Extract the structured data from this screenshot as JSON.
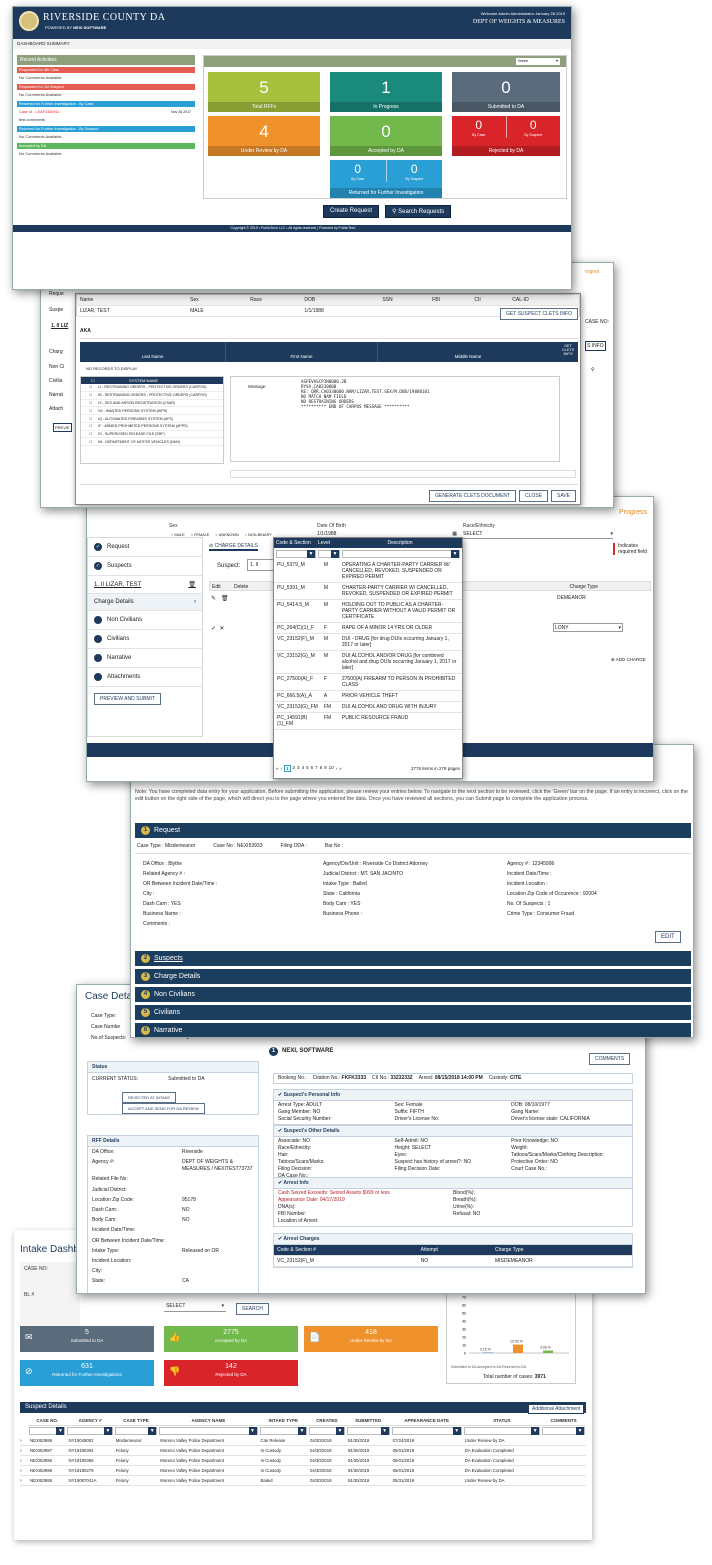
{
  "win1": {
    "brand": "RIVERSIDE COUNTY DA",
    "powered": "POWERED BY",
    "vendor": "NEXI SOFTWARE",
    "welcome": "Welcome Admin Administrator January 28 2019",
    "dept": "DEPT OF WEIGHTS & MEASURES",
    "page_label": "DASHBOARD SUMMARY",
    "recent_header": "Recent Activities",
    "activities": [
      {
        "title": "Requested for 4th Case",
        "text": "No Comments Available.",
        "color": "#e45b4f",
        "date": ""
      },
      {
        "title": "Requested for 1st Suspect",
        "text": "No Comments Available.",
        "color": "#e45b4f",
        "date": ""
      },
      {
        "title": "Returned for Further Investigation - By Case",
        "text": "",
        "color": "#2a9fd6",
        "date": ""
      },
      {
        "title": "Case Id - LEAF3330911",
        "text": "test comments",
        "color": "#ffffff",
        "date": "Nov 28 2017"
      },
      {
        "title": "Returned for Further Investigation - By Suspect",
        "text": "No Comments Available.",
        "color": "#2a9fd6",
        "date": ""
      },
      {
        "title": "Accepted by DA",
        "text": "No Comments Available.",
        "color": "#5cb85c",
        "date": ""
      }
    ],
    "select_value": "Week",
    "tiles": [
      {
        "value": "5",
        "label": "Total RFFs",
        "color": "#a7c13e"
      },
      {
        "value": "1",
        "label": "In Progress",
        "color": "#1a8a7c"
      },
      {
        "value": "0",
        "label": "Submitted to DA",
        "color": "#5a6b7c"
      },
      {
        "value": "4",
        "label": "Under Review by DA",
        "color": "#f0922c"
      },
      {
        "value": "0",
        "label": "Accepted by DA",
        "color": "#72b84a"
      }
    ],
    "rejected": {
      "case": "0",
      "suspect": "0",
      "case_lbl": "By Case",
      "suspect_lbl": "By Suspect",
      "label": "Rejected by DA"
    },
    "returned": {
      "case": "0",
      "suspect": "0",
      "case_lbl": "By Case",
      "suspect_lbl": "By Suspect",
      "label": "Returned for Further Investigation"
    },
    "create_btn": "Create Request",
    "search_btn": "Search Requests",
    "copyright": "Copyright © 2019 • PublicTech LLC • All rights reserved | Powered by PublicTech"
  },
  "win2": {
    "cols": [
      "Name",
      "Sex",
      "Race",
      "DOB",
      "SSN",
      "FBI",
      "CII",
      "CAL-ID"
    ],
    "row": [
      "LIZAR, TEST",
      "MALE",
      "",
      "1/1/1988",
      "",
      "",
      "",
      ""
    ],
    "suspect_btn": "GET SUSPECT CLETS INFO",
    "aka": "AKA",
    "aka_cols": [
      "Last Name",
      "First Name",
      "Middle Name",
      "GET CLETS INFO"
    ],
    "no_records": "NO RECORDS TO DISPLAY",
    "system_header": "SYSTEM NAME",
    "systems": [
      "LI - RESTRAINING ORDERS - PROTECTIVE ORDERS (CARPOS)",
      "IB - RESTRAINING ORDERS - PROTECTIVE ORDERS (CARPOS)",
      "IX - SEX AND ARSON REGISTRATION (CSAR)",
      "IW - WANTED PERSONS SYSTEM (WPS)",
      "IQ - AUTOMATED FIREARMS SYSTEM (AFS)",
      "IF - ARMED PROHIBITED PERSONS SYSTEM (APPS)",
      "IS - SUPERVISED RELEASE FILE (SRF)",
      "IM - DEPARTMENT OF MOTOR VEHICLES (DMV)"
    ],
    "message_label": "Message:",
    "message": "ASPEVASCP1N0000.2B\nRYVA.CA0330000\nRE: QRR.CA0330000.NAM/LIZAR,TEST.SEX/M.DOB/19880101\nNO MATCH NAM FIELD\nNO RESTRAINING ORDERS\n********** END OF CARPOS MESSAGE **********",
    "btn_generate": "GENERATE CLETS DOCUMENT",
    "btn_close": "CLOSE",
    "btn_save": "SAVE",
    "side_partial": [
      "Reque",
      "Suspe",
      "1. II LIZ",
      "Charg",
      "Non Ci",
      "Civilia",
      "Narrat",
      "Attach",
      "PREVIE"
    ],
    "right_partial": [
      "rogres",
      "CASE NO:",
      "S INFO"
    ]
  },
  "win3": {
    "sex_label": "Sex",
    "sex_options": [
      "MALE",
      "FEMALE",
      "UNKNOWN",
      "NON-BINARY"
    ],
    "dob_label": "Date Of Birth",
    "dob_value": "1/1/1988",
    "race_label": "Race/Ethnicity",
    "race_value": "SELECT",
    "progress": "Progress",
    "side": [
      "Request",
      "Suspects",
      "1. II LIZAR, TEST",
      "Charge Details",
      "Non Civilians",
      "Civilians",
      "Narrative",
      "Attachments"
    ],
    "preview_btn": "PREVIEW AND SUBMIT",
    "tab_label": "CHARGE DETAILS",
    "suspect_lbl": "Suspect:",
    "required": "Indicates required field",
    "grid_cols": [
      "Edit",
      "Delete"
    ],
    "charge_type": "Charge Type",
    "misdemeanor": "DEMEANOR",
    "felony": "LONY",
    "add_charge": "ADD CHARGE",
    "popup_cols": [
      "Code & Section",
      "Level",
      "Description"
    ],
    "codes": [
      {
        "code": "PU_5379_M",
        "level": "M",
        "desc": "OPERATING A CHARTER-PARTY CARRIER W/ CANCELLED, REVOKED, SUSPENDED OR EXPIRED PERMIT"
      },
      {
        "code": "PU_5391_M",
        "level": "M",
        "desc": "CHARTER-PARTY CARRIER W/ CANCELLED, REVOKED, SUSPENDED OR EXPIRED PERMIT"
      },
      {
        "code": "PU_5414.5_M",
        "level": "M",
        "desc": "HOLDING OUT TO PUBLIC AS A CHARTER-PARTY CARRIER WITHOUT A VALID PERMIT OR CERTIFICATE"
      },
      {
        "code": "PC_264(C)(1)_F",
        "level": "F",
        "desc": "RAPE OF A MINOR 14 YRS OR OLDER"
      },
      {
        "code": "VC_23152(F)_M",
        "level": "M",
        "desc": "DUI - DRUG [for drug DUIs occurring January 1, 2017 or later]"
      },
      {
        "code": "VC_23152(G)_M",
        "level": "M",
        "desc": "DUI ALCOHOL AND/OR DRUG [for combined alcohol and drug DUIs occurring January 1, 2017 or later]"
      },
      {
        "code": "PC_27500(A)_F",
        "level": "F",
        "desc": "27500(A) FIREARM TO PERSON IN PROHIBITED CLASS"
      },
      {
        "code": "PC_666.5(A)_A",
        "level": "A",
        "desc": "PRIOR VEHICLE THEFT"
      },
      {
        "code": "VC_23153(G)_FM",
        "level": "FM",
        "desc": "DUI ALCOHOL AND DRUG WITH INJURY"
      },
      {
        "code": "PC_14591(B)(1)_FM",
        "level": "FM",
        "desc": "PUBLIC RESOURCE FRAUD"
      }
    ],
    "pager": [
      "1",
      "2",
      "3",
      "4",
      "5",
      "6",
      "7",
      "8",
      "9",
      "10"
    ],
    "items_info": "2778 items in 278 pages"
  },
  "win4": {
    "note": "Note: You have completed data entry for your application. Before submitting the application, please review your entries below. To navigate to the next section to be reviewed, click the 'Green' bar on the page. If an entry is incorrect, click on the edit button on the right side of the page, which will direct you to the page where you entered the data. Once you have reviewed all sections, you can Submit page to complete the application process.",
    "request_header": "Request",
    "case_type": "Case Type : Misdemeanor",
    "case_no": "Case No : NEXI53933",
    "filing_dda": "Filing DDA :",
    "bar_no": "Bar No :",
    "col1": [
      "DA Office : Blythe",
      "Related Agency # :",
      "OR Between Incident Date/Time :",
      "City :",
      "Dash Cam : YES",
      "Business Name :",
      "Comments :"
    ],
    "col2": [
      "Agency/Div/Unit : Riverside Co District Attorney",
      "Judicial District : MT. SAN JACINTO",
      "Intake Type : Bailed",
      "State : California",
      "Body Cam : YES",
      "Business Phone :"
    ],
    "col3": [
      "Agency # : 12345996",
      "Incident Date/Time :",
      "Incident Location :",
      "Location Zip Code of Occurence : 92004",
      "No. Of Suspects : 1",
      "Crime Type : Consumer Fraud"
    ],
    "edit": "EDIT",
    "sections": [
      {
        "num": "2",
        "label": "Suspects"
      },
      {
        "num": "3",
        "label": "Charge Details"
      },
      {
        "num": "4",
        "label": "Non Civilians"
      },
      {
        "num": "5",
        "label": "Civilians"
      },
      {
        "num": "6",
        "label": "Narrative"
      }
    ]
  },
  "win5": {
    "title": "Case Deta",
    "case_type": "Case Type:",
    "case_number": "Case Numbe",
    "num_suspects": "No.of Suspects:",
    "num_suspects_val": "1",
    "status_title": "Status",
    "current_status_lbl": "CURRENT STATUS:",
    "current_status": "Submitted to DA",
    "reject_btn": "REJECTED AT INTAKE",
    "accept_btn": "ACCEPT AND SEND FOR DA REVIEW",
    "rff_title": "RFF Details",
    "rff": [
      [
        "DA Office:",
        "Riverside"
      ],
      [
        "Agency #:",
        "DEPT OF WEIGHTS & MEASURES / NEXITEST73737"
      ],
      [
        "Related File No:",
        ""
      ],
      [
        "Judicial District:",
        ""
      ],
      [
        "Location Zip Code:",
        "95178"
      ],
      [
        "Dash Cam:",
        "NO"
      ],
      [
        "Body Cam:",
        "NO"
      ],
      [
        "Incident Date/Time:",
        ""
      ],
      [
        "OR Between Incident Date/Time:",
        ""
      ],
      [
        "Intake Type:",
        "Released on OR"
      ],
      [
        "Incident Location:",
        ""
      ],
      [
        "City:",
        ""
      ],
      [
        "State:",
        "CA"
      ]
    ],
    "suspect_name": "NEXI, SOFTWARE",
    "comments_btn": "COMMENTS",
    "booking": "Booking No.:",
    "citation": "Citation No.:",
    "citation_val": "FKFK3333",
    "cii": "CII No.:",
    "cii_val": "33232332",
    "arrest": "Arrest:",
    "arrest_val": "08/15/2018 14:00 PM",
    "custody": "Custody:",
    "custody_val": "CITE",
    "personal_title": "Suspect's Personal Info",
    "personal": [
      [
        "Arrest Type: ADULT",
        "Sex: Female",
        "DOB: 08/10/1977"
      ],
      [
        "Gang Member: NO",
        "Suffix: FIFTH",
        "Gang Name:"
      ],
      [
        "Social Security Number:",
        "Driver's License No:",
        "Driver's license state: CALIFORNIA"
      ]
    ],
    "other_title": "Suspect's Other Details",
    "other": [
      [
        "Associate: NO",
        "Self-Admit: NO",
        "Prior Knowledge: NO"
      ],
      [
        "Race/Ethnicity:",
        "Height: SELECT",
        "Weight:"
      ],
      [
        "Hair:",
        "Eyes:",
        "Tattoos/Scars/Marks/Clothing Description:"
      ],
      [
        "Tattoos/Scars/Marks:",
        "Suspect has history of arrest?: NO",
        "Protective Order: NO"
      ],
      [
        "Filing Decision:",
        "Filing Decision Date:",
        "Court Case No.:"
      ],
      [
        "DA Case No.:",
        "",
        ""
      ]
    ],
    "arrest_title": "Arrest Info",
    "arrest_rows": [
      [
        "Cash Seized Exceeds: Seized Assets $999 or less",
        "Blood(%):"
      ],
      [
        "Appearance Date: 04/17/2019",
        "Breath(%):"
      ],
      [
        "DNA(s):",
        "Urine(%):"
      ],
      [
        "FBI Number:",
        "Refusal: NO"
      ],
      [
        "Location of Arrest:",
        ""
      ]
    ],
    "charges_title": "Arrest Charges",
    "charges_cols": [
      "Code & Section #",
      "Attempt",
      "Charge Type"
    ],
    "charges_row": [
      "VC_23152(F)_M",
      "NO",
      "MISDEMEANOR"
    ]
  },
  "win6": {
    "title": "Intake Dashboar",
    "case_no_lbl": "CASE NO:",
    "bl_lbl": "BL #",
    "select": "SELECT",
    "search_btn": "SEARCH",
    "tiles": [
      {
        "value": "5",
        "label": "Submitted to DA",
        "color": "#5a6b7c",
        "icon": "envelope-icon",
        "glyph": "✉"
      },
      {
        "value": "2775",
        "label": "Accepted by DA",
        "color": "#72b84a",
        "icon": "thumbs-up-icon",
        "glyph": "👍"
      },
      {
        "value": "418",
        "label": "Under Review by DA",
        "color": "#f0922c",
        "icon": "document-icon",
        "glyph": "📄"
      },
      {
        "value": "631",
        "label": "Returned for Further Investigations",
        "color": "#2a9fd6",
        "icon": "block-icon",
        "glyph": "⊘"
      },
      {
        "value": "142",
        "label": "Rejected by DA",
        "color": "#d9242a",
        "icon": "thumbs-down-icon",
        "glyph": "👎"
      }
    ],
    "chart_total": "Total number of cases:",
    "chart_total_val": "3971",
    "chart_caption": "Submitted to DA Accepted to DA Returned to DA",
    "suspect_details": "Suspect Details",
    "additional": "Additional Attachment",
    "cols": [
      "CASE NO.",
      "AGENCY #",
      "CASE TYPE",
      "AGENCY NAME",
      "INTAKE TYPE",
      "CREATED",
      "SUBMITTED",
      "APPEARANCE DATE",
      "STATUS",
      "COMMENTS"
    ],
    "rows": [
      [
        "NEXI53998",
        "NY19049002",
        "Misdemeanor",
        "Moreno Valley Police Department",
        "Cite Release",
        "04/30/2019",
        "04/30/2019",
        "07/24/2019",
        "Under Review by DA"
      ],
      [
        "NEXI53997",
        "NY19190304",
        "Felony",
        "Moreno Valley Police Department",
        "In Custody",
        "04/30/2019",
        "04/30/2019",
        "05/01/2019",
        "DA Evaluation Completed"
      ],
      [
        "NEXI53996",
        "NY19190365",
        "Felony",
        "Moreno Valley Police Department",
        "In Custody",
        "04/30/2019",
        "04/30/2019",
        "05/01/2019",
        "DA Evaluation Completed"
      ],
      [
        "NEXI53996",
        "NY19180279",
        "Felony",
        "Moreno Valley Police Department",
        "In Custody",
        "04/30/2019",
        "04/30/2019",
        "05/01/2019",
        "DA Evaluation Completed"
      ],
      [
        "NEXI53995",
        "NY19087041A",
        "Felony",
        "Moreno Valley Police Department",
        "Bailed",
        "04/30/2019",
        "04/30/2019",
        "05/31/2019",
        "Under Review by DA"
      ]
    ]
  },
  "chart_data": {
    "type": "bar",
    "categories": [
      "Submitted to DA",
      "Accepted to DA",
      "Returned to DA"
    ],
    "values": [
      0.15,
      10.53,
      3.08
    ],
    "value_labels": [
      "0.15 %",
      "10.53 %",
      "3.08 %"
    ],
    "ylim": [
      0,
      70
    ],
    "y_ticks": [
      "70",
      "60",
      "50",
      "40",
      "30",
      "20",
      "10",
      "0"
    ],
    "colors": [
      "#6c8ebf",
      "#f0922c",
      "#72b84a"
    ]
  }
}
